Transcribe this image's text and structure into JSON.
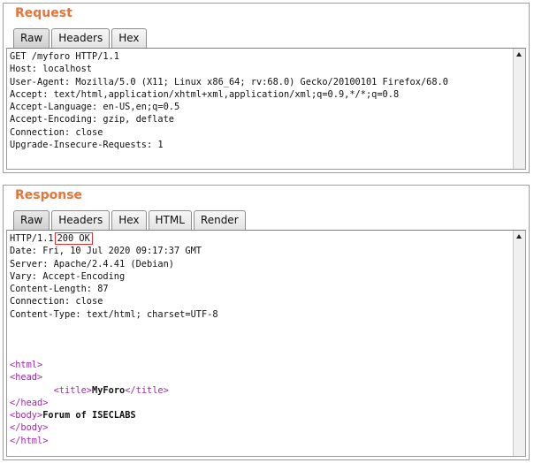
{
  "request": {
    "title": "Request",
    "tabs": [
      "Raw",
      "Headers",
      "Hex"
    ],
    "active_tab": "Raw",
    "lines": [
      "GET /myforo HTTP/1.1",
      "Host: localhost",
      "User-Agent: Mozilla/5.0 (X11; Linux x86_64; rv:68.0) Gecko/20100101 Firefox/68.0",
      "Accept: text/html,application/xhtml+xml,application/xml;q=0.9,*/*;q=0.8",
      "Accept-Language: en-US,en;q=0.5",
      "Accept-Encoding: gzip, deflate",
      "Connection: close",
      "Upgrade-Insecure-Requests: 1"
    ]
  },
  "response": {
    "title": "Response",
    "tabs": [
      "Raw",
      "Headers",
      "Hex",
      "HTML",
      "Render"
    ],
    "active_tab": "Raw",
    "status_protocol": "HTTP/1.1",
    "status_code": "200 OK",
    "header_lines": [
      "Date: Fri, 10 Jul 2020 09:17:37 GMT",
      "Server: Apache/2.4.41 (Debian)",
      "Vary: Accept-Encoding",
      "Content-Length: 87",
      "Connection: close",
      "Content-Type: text/html; charset=UTF-8"
    ],
    "body": {
      "html_open": "<html>",
      "head_open": "<head>",
      "title_open": "<title>",
      "title_text": "MyForo",
      "title_close": "</title>",
      "head_close": "</head>",
      "body_open": "<body>",
      "body_text": "Forum of ISECLABS",
      "body_close": "</body>",
      "html_close": "</html>"
    }
  },
  "colors": {
    "title_orange": "#e8743b",
    "tag_purple": "#9b2ea6",
    "highlight_red": "#e03030"
  },
  "icons": {
    "scroll_up": "scroll-up-arrow-icon"
  }
}
